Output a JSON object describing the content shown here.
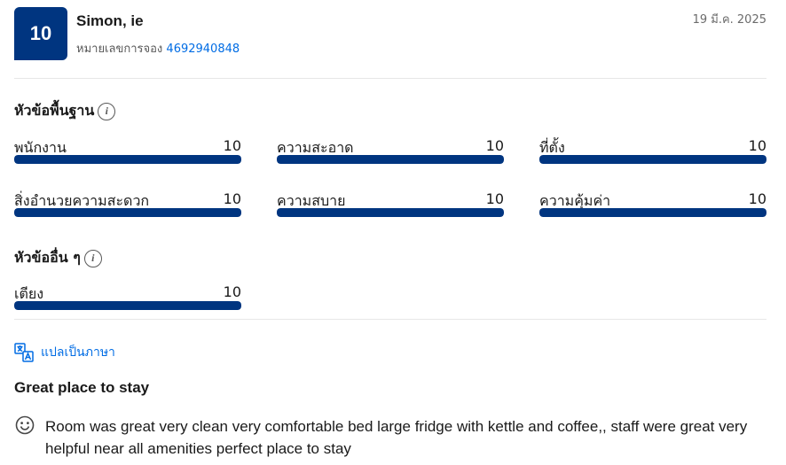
{
  "review": {
    "score": "10",
    "reviewer_name": "Simon, ie",
    "booking_label": "หมายเลขการจอง",
    "booking_number": "4692940848",
    "date": "19 มี.ค. 2025"
  },
  "basic_section": {
    "title": "หัวข้อพื้นฐาน",
    "info_icon": "info-icon",
    "ratings": [
      {
        "label": "พนักงาน",
        "value": "10",
        "fraction": 1.0
      },
      {
        "label": "ความสะอาด",
        "value": "10",
        "fraction": 1.0
      },
      {
        "label": "ที่ตั้ง",
        "value": "10",
        "fraction": 1.0
      },
      {
        "label": "สิ่งอำนวยความสะดวก",
        "value": "10",
        "fraction": 1.0
      },
      {
        "label": "ความสบาย",
        "value": "10",
        "fraction": 1.0
      },
      {
        "label": "ความคุ้มค่า",
        "value": "10",
        "fraction": 1.0
      }
    ]
  },
  "other_section": {
    "title": "หัวข้ออื่น ๆ",
    "info_icon": "info-icon",
    "ratings": [
      {
        "label": "เตียง",
        "value": "10",
        "fraction": 1.0
      }
    ]
  },
  "translate": {
    "label": "แปลเป็นภาษา",
    "icon": "translate-icon"
  },
  "review_title": "Great place to stay",
  "review_body": {
    "icon": "smile-icon",
    "text": "Room was great very clean very comfortable bed large fridge with kettle and coffee,, staff were great very helpful near all amenities perfect place to stay"
  },
  "colors": {
    "brand": "#003580",
    "link": "#006ce4",
    "track": "#e7e7e7"
  }
}
